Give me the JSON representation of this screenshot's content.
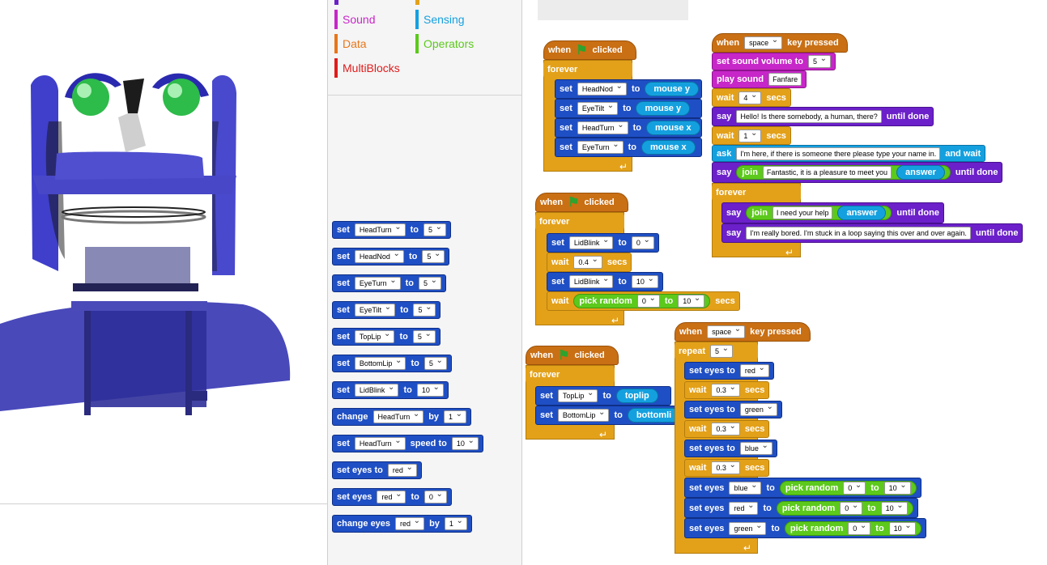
{
  "categories": [
    {
      "label": "Sound",
      "color": "#c726c8"
    },
    {
      "label": "Sensing",
      "color": "#14a0df"
    },
    {
      "label": "Data",
      "color": "#e8761a"
    },
    {
      "label": "Operators",
      "color": "#5cc91c"
    },
    {
      "label": "MultiBlocks",
      "color": "#e01b1b"
    }
  ],
  "kw": {
    "set": "set",
    "to": "to",
    "by": "by",
    "change": "change",
    "speed_to": "speed to",
    "set_eyes_to": "set eyes to",
    "set_eyes": "set eyes",
    "change_eyes": "change eyes",
    "when": "when",
    "clicked": "clicked",
    "forever": "forever",
    "wait": "wait",
    "secs": "secs",
    "pick_random": "pick random",
    "key_pressed": "key pressed",
    "repeat": "repeat",
    "say": "say",
    "until_done": "until done",
    "ask": "ask",
    "and_wait": "and wait",
    "join": "join",
    "set_sound_volume_to": "set sound volume to",
    "play_sound": "play sound"
  },
  "palette_blocks": [
    {
      "var": "HeadTurn",
      "val": "5"
    },
    {
      "var": "HeadNod",
      "val": "5"
    },
    {
      "var": "EyeTurn",
      "val": "5"
    },
    {
      "var": "EyeTilt",
      "val": "5"
    },
    {
      "var": "TopLip",
      "val": "5"
    },
    {
      "var": "BottomLip",
      "val": "5"
    },
    {
      "var": "LidBlink",
      "val": "10"
    }
  ],
  "palette_extra": {
    "change_var": "HeadTurn",
    "change_val": "1",
    "speed_var": "HeadTurn",
    "speed_val": "10",
    "eyes_color": "red",
    "set_eyes_color": "red",
    "set_eyes_val": "0",
    "change_eyes_color": "red",
    "change_eyes_val": "1"
  },
  "script1": {
    "rows": [
      {
        "var": "HeadNod",
        "reporter": "mouse y"
      },
      {
        "var": "EyeTilt",
        "reporter": "mouse y"
      },
      {
        "var": "HeadTurn",
        "reporter": "mouse x"
      },
      {
        "var": "EyeTurn",
        "reporter": "mouse x"
      }
    ]
  },
  "script2": {
    "blink_var": "LidBlink",
    "blink_val1": "0",
    "wait_val": "0.4",
    "blink_val2": "10",
    "rand_from": "0",
    "rand_to": "10"
  },
  "script3": {
    "rows": [
      {
        "var": "TopLip",
        "reporter": "toplip"
      },
      {
        "var": "BottomLip",
        "reporter": "bottomli"
      }
    ]
  },
  "script4": {
    "key": "space",
    "volume": "5",
    "sound": "Fanfare",
    "wait1": "4",
    "say1": "Hello! Is there somebody, a human, there?",
    "wait2": "1",
    "ask": "I'm here, if there is someone there please type your name in.",
    "join1_text": "Fantastic, it is a pleasure to meet you",
    "answer": "answer",
    "join2_text": "I need your help",
    "say3": "I'm really bored. I'm stuck in a loop saying this over and over again."
  },
  "script5": {
    "key": "space",
    "repeat": "5",
    "eyes": [
      {
        "color": "red",
        "wait": "0.3"
      },
      {
        "color": "green",
        "wait": "0.3"
      },
      {
        "color": "blue",
        "wait": "0.3"
      }
    ],
    "rand_rows": [
      {
        "color": "blue",
        "from": "0",
        "to": "10"
      },
      {
        "color": "red",
        "from": "0",
        "to": "10"
      },
      {
        "color": "green",
        "from": "0",
        "to": "10"
      }
    ]
  }
}
